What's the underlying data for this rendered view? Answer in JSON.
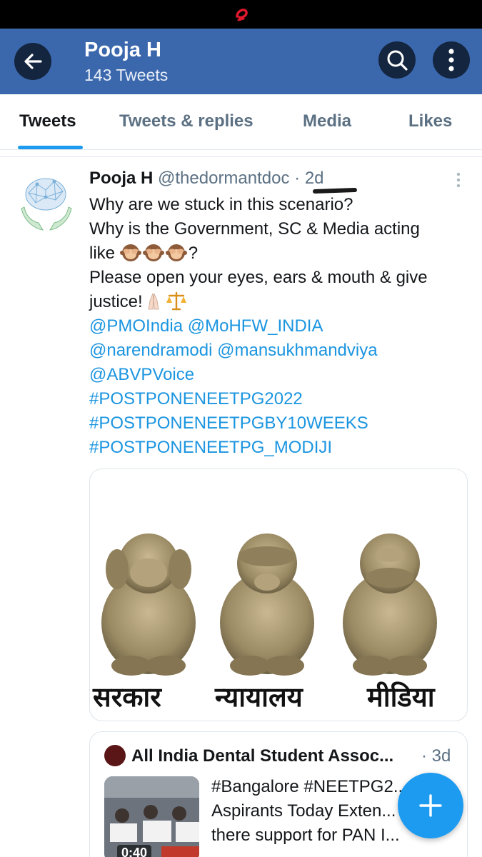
{
  "header": {
    "title": "Pooja H",
    "subtitle": "143 Tweets"
  },
  "tabs": [
    {
      "label": "Tweets",
      "active": true
    },
    {
      "label": "Tweets & replies",
      "active": false
    },
    {
      "label": "Media",
      "active": false
    },
    {
      "label": "Likes",
      "active": false
    }
  ],
  "tweet": {
    "name": "Pooja H",
    "handle": "@thedormantdoc",
    "separator": "·",
    "time": "2d",
    "lines": {
      "l1": "Why are we stuck in this scenario?",
      "l2": "Why is the Government, SC & Media acting",
      "l3_prefix": "like ",
      "l3_suffix": "?",
      "l4": "Please open your eyes, ears & mouth & give",
      "l5": "justice!"
    },
    "emojis": [
      "see-no-evil-monkey",
      "see-no-evil-monkey",
      "see-no-evil-monkey",
      "folded-hands",
      "balance-scale"
    ],
    "links": {
      "l6": "@PMOIndia @MoHFW_INDIA",
      "l7": "@narendramodi @mansukhmandviya",
      "l8": "@ABVPVoice",
      "l9": "#POSTPONENEETPG2022",
      "l10": "#POSTPONENEETPGBY10WEEKS",
      "l11": "#POSTPONENEETPG_MODIJI"
    },
    "image_captions": [
      "सरकार",
      "न्यायालय",
      "मीडिया"
    ]
  },
  "quote": {
    "name": "All India Dental Student Assoc...",
    "separator": "·",
    "time": "3d",
    "video_duration": "0:40",
    "lines": [
      "#Bangalore #NEETPG2...",
      "Aspirants Today Exten...",
      "there support  for PAN I..."
    ]
  },
  "colors": {
    "header_bg": "#3b68ad",
    "accent": "#1d9bf0",
    "link": "#1b95e0"
  }
}
